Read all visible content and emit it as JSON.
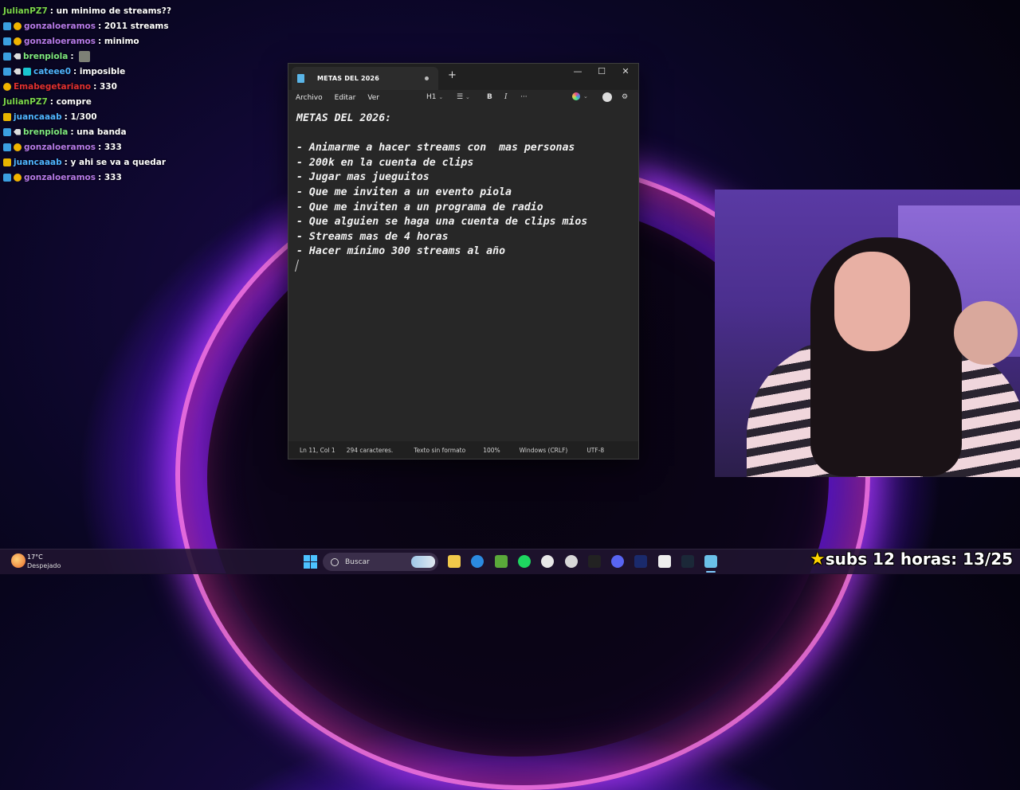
{
  "chat": [
    {
      "user": "JulianPZ7",
      "color": "#7bd64b",
      "badges": [],
      "message": ": un minimo de streams??"
    },
    {
      "user": "gonzaloeramos",
      "color": "#b67ae8",
      "badges": [
        "prime",
        "sub"
      ],
      "message": ": 2011 streams"
    },
    {
      "user": "gonzaloeramos",
      "color": "#b67ae8",
      "badges": [
        "prime",
        "sub"
      ],
      "message": ": minimo"
    },
    {
      "user": "brenpiola",
      "color": "#7ee87e",
      "badges": [
        "prime",
        "pen"
      ],
      "message": ": ",
      "emote": true
    },
    {
      "user": "cateee0",
      "color": "#4fb4ff",
      "badges": [
        "prime",
        "pen",
        "cyan"
      ],
      "message": ": imposible"
    },
    {
      "user": "Emabegetariano",
      "color": "#e03030",
      "badges": [
        "sub"
      ],
      "message": ": 330"
    },
    {
      "user": "JulianPZ7",
      "color": "#7bd64b",
      "badges": [],
      "message": ": compre"
    },
    {
      "user": "juancaaab",
      "color": "#4fb4ff",
      "badges": [
        "vip"
      ],
      "message": ": 1/300"
    },
    {
      "user": "brenpiola",
      "color": "#7ee87e",
      "badges": [
        "prime",
        "pen"
      ],
      "message": ": una banda"
    },
    {
      "user": "gonzaloeramos",
      "color": "#b67ae8",
      "badges": [
        "prime",
        "sub"
      ],
      "message": ": 333"
    },
    {
      "user": "juancaaab",
      "color": "#4fb4ff",
      "badges": [
        "vip"
      ],
      "message": ": y ahi se va a quedar"
    },
    {
      "user": "gonzaloeramos",
      "color": "#b67ae8",
      "badges": [
        "prime",
        "sub"
      ],
      "message": ": 333"
    }
  ],
  "notepad": {
    "tab_title": "METAS DEL 2026",
    "new_tab": "+",
    "window_controls": {
      "minimize": "—",
      "maximize": "☐",
      "close": "✕"
    },
    "menu": [
      "Archivo",
      "Editar",
      "Ver"
    ],
    "toolbar": {
      "heading": "H1",
      "bold": "B",
      "italic": "I",
      "more": "···"
    },
    "lines": [
      "METAS DEL 2026:",
      "",
      "- Animarme a hacer streams con  mas personas",
      "- 200k en la cuenta de clips",
      "- Jugar mas jueguitos",
      "- Que me inviten a un evento piola",
      "- Que me inviten a un programa de radio",
      "- Que alguien se haga una cuenta de clips mios",
      "- Streams mas de 4 horas",
      "- Hacer mínimo 300 streams al año"
    ],
    "status": {
      "position": "Ln 11, Col 1",
      "chars": "294 caracteres.",
      "format": "Texto sin formato",
      "zoom": "100%",
      "line_ending": "Windows (CRLF)",
      "encoding": "UTF-8"
    }
  },
  "taskbar": {
    "weather_temp": "17°C",
    "weather_desc": "Despejado",
    "search_placeholder": "Buscar",
    "apps": [
      "file-explorer-icon",
      "edge-icon",
      "minecraft-icon",
      "spotify-icon",
      "chrome-icon",
      "obs-icon",
      "davinci-icon",
      "discord-icon",
      "photoshop-icon",
      "capcut-icon",
      "steam-icon",
      "notepad-icon"
    ]
  },
  "overlay": {
    "text": "subs 12 horas: 13/25"
  },
  "colors": {
    "accent": "#4cc2ff",
    "prime": "#3b9fe0",
    "sub_badge": "#f1b400"
  }
}
